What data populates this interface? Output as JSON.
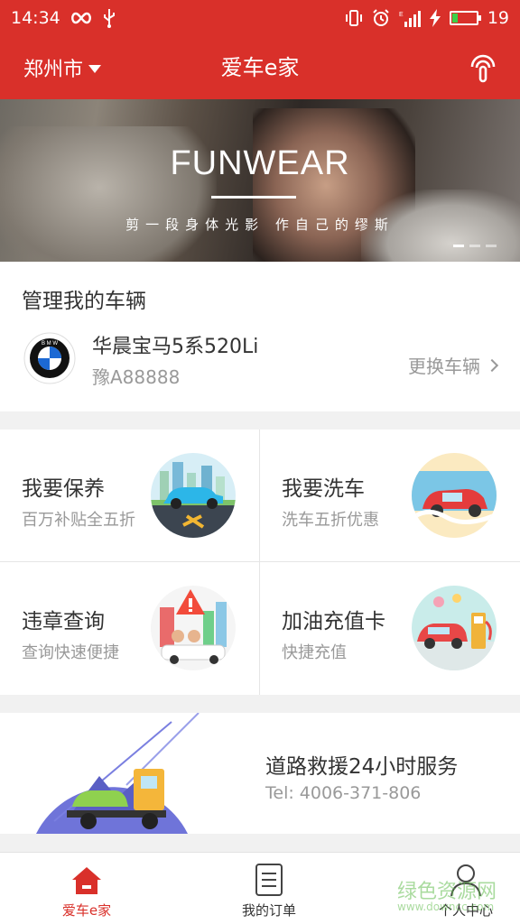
{
  "status_bar": {
    "time": "14:34",
    "battery": "19",
    "icons": [
      "infinity-icon",
      "usb-icon",
      "vibrate-icon",
      "alarm-icon",
      "signal-icon",
      "charging-icon",
      "battery-icon"
    ]
  },
  "header": {
    "city": "郑州市",
    "title": "爱车e家",
    "right_icon": "signal-broadcast-icon"
  },
  "banner": {
    "title": "FUNWEAR",
    "subtitle": "剪一段身体光影 作自己的缪斯",
    "slide_index": 1,
    "slide_count": 3
  },
  "vehicle": {
    "heading": "管理我的车辆",
    "brand_icon": "bmw-logo",
    "name": "华晨宝马5系520Li",
    "plate": "豫A88888",
    "change_label": "更换车辆"
  },
  "services": [
    {
      "title": "我要保养",
      "subtitle": "百万补贴全五折",
      "icon": "maintenance-illustration"
    },
    {
      "title": "我要洗车",
      "subtitle": "洗车五折优惠",
      "icon": "car-wash-illustration"
    },
    {
      "title": "违章查询",
      "subtitle": "查询快速便捷",
      "icon": "violation-illustration"
    },
    {
      "title": "加油充值卡",
      "subtitle": "快捷充值",
      "icon": "fuel-illustration"
    }
  ],
  "rescue": {
    "title": "道路救援24小时服务",
    "tel": "Tel: 4006-371-806",
    "icon": "tow-truck-illustration"
  },
  "tabs": [
    {
      "label": "爱车e家",
      "icon": "home-icon",
      "active": true
    },
    {
      "label": "我的订单",
      "icon": "order-list-icon",
      "active": false
    },
    {
      "label": "个人中心",
      "icon": "user-icon",
      "active": false
    }
  ],
  "watermark": {
    "text": "绿色资源网",
    "sub": "www.downcc.com"
  },
  "colors": {
    "brand_red": "#d9302a",
    "text_dark": "#333333",
    "text_gray": "#999999"
  }
}
